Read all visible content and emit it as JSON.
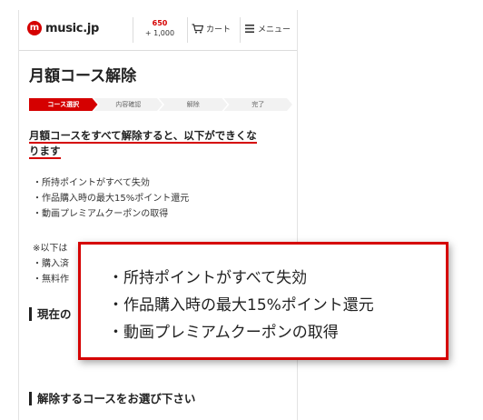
{
  "header": {
    "logo_text": "music.jp",
    "points_main": "650",
    "points_sub": "+ 1,000",
    "cart_label": "カート",
    "menu_label": "メニュー"
  },
  "page": {
    "title": "月額コース解除",
    "steps": [
      {
        "label": "コース選択",
        "active": true
      },
      {
        "label": "内容確認",
        "active": false
      },
      {
        "label": "解除",
        "active": false
      },
      {
        "label": "完了",
        "active": false
      }
    ],
    "warning_line1": "月額コースをすべて解除すると、以下ができくな",
    "warning_line2": "ります",
    "loss_items": [
      "所持ポイントがすべて失効",
      "作品購入時の最大15%ポイント還元",
      "動画プレミアムクーポンの取得"
    ],
    "note_prefix": "※以下は",
    "note_items": [
      "購入済",
      "無料作"
    ],
    "section_current": "現在の",
    "section_choose": "解除するコースをお選び下さい"
  },
  "callout": {
    "items": [
      "所持ポイントがすべて失効",
      "作品購入時の最大15%ポイント還元",
      "動画プレミアムクーポンの取得"
    ]
  },
  "colors": {
    "accent": "#d50000"
  }
}
